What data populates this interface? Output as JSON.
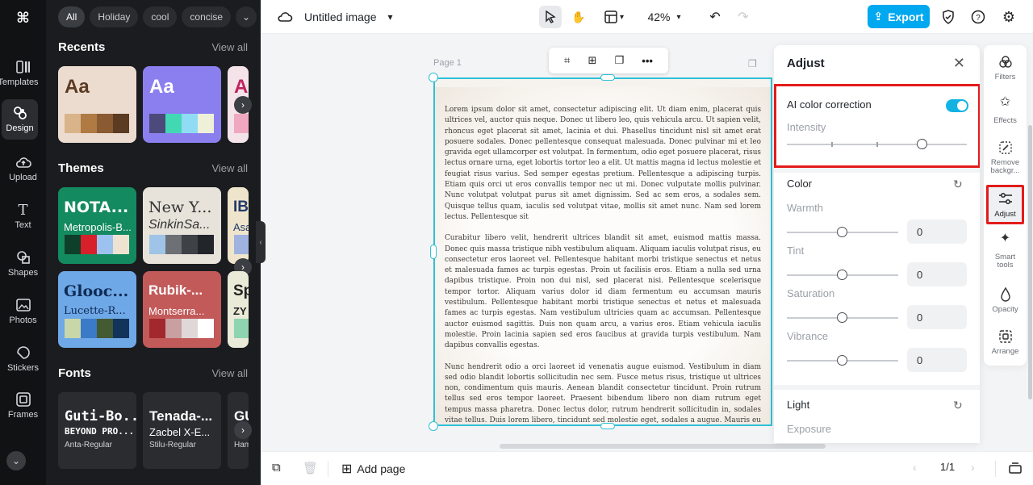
{
  "left_rail": {
    "logo": "⌘",
    "items": [
      {
        "label": "Templates"
      },
      {
        "label": "Design"
      },
      {
        "label": "Upload"
      },
      {
        "label": "Text"
      },
      {
        "label": "Shapes"
      },
      {
        "label": "Photos"
      },
      {
        "label": "Stickers"
      },
      {
        "label": "Frames"
      }
    ]
  },
  "panel": {
    "chips": [
      "All",
      "Holiday",
      "cool",
      "concise"
    ],
    "recents": {
      "title": "Recents",
      "view_all": "View all"
    },
    "recent_cards": [
      {
        "text": "Aa",
        "bg": "#ecdcd0",
        "color": "#5b3b22",
        "swatches": [
          "#d9b48a",
          "#b07a45",
          "#8a5a33",
          "#5b3b22"
        ]
      },
      {
        "text": "Aa",
        "bg": "#8b7ff0",
        "color": "#ffffff",
        "swatches": [
          "#4b4a7a",
          "#43d8b4",
          "#8fdcf4",
          "#eef0d8"
        ]
      },
      {
        "text": "A",
        "bg": "#f4e4ea",
        "color": "#c0245e",
        "swatches": [
          "#f0a8c0",
          "#e6e6e6"
        ]
      }
    ],
    "themes": {
      "title": "Themes",
      "view_all": "View all"
    },
    "theme_cards": [
      {
        "name": "NOTA...",
        "sub": "Metropolis-B...",
        "bg": "#138a5f",
        "color": "#ffffff",
        "swatches": [
          "#0e3f2b",
          "#d8202a",
          "#9cc2f0",
          "#eee2d0"
        ]
      },
      {
        "name": "New Y...",
        "sub": "SinkinSa...",
        "bg": "#e7e2da",
        "color": "#333333",
        "swatches": [
          "#9fc4e8",
          "#6d7075",
          "#3e4247",
          "#22262b"
        ]
      },
      {
        "name": "IB",
        "sub": "Asa",
        "bg": "#efe5cc",
        "color": "#223a6a",
        "swatches": [
          "#9fb2e0"
        ]
      },
      {
        "name": "Glooc...",
        "sub": "Lucette-R...",
        "bg": "#6fa8e6",
        "color": "#0e2a55",
        "swatches": [
          "#c8d6a8",
          "#3b7ac8",
          "#435a32",
          "#12345a"
        ]
      },
      {
        "name": "Rubik-...",
        "sub": "Montserra...",
        "bg": "#c25a5a",
        "color": "#ffffff",
        "swatches": [
          "#a3282e",
          "#c8a0a0",
          "#e0d8d8",
          "#ffffff"
        ]
      },
      {
        "name": "Sp",
        "sub": "ZY",
        "bg": "#e9ead8",
        "color": "#222222",
        "swatches": [
          "#8fd4b0"
        ]
      }
    ],
    "fonts": {
      "title": "Fonts",
      "view_all": "View all"
    },
    "font_cards": [
      {
        "l1": "Guti-Bo...",
        "l2": "BEYOND PRO...",
        "l3": "Anta-Regular"
      },
      {
        "l1": "Tenada-...",
        "l2": "Zacbel X-E...",
        "l3": "Stilu-Regular"
      },
      {
        "l1": "GU",
        "l2": "",
        "l3": "Ham"
      }
    ]
  },
  "topbar": {
    "doc_title": "Untitled image",
    "zoom": "42%",
    "export_label": "Export"
  },
  "canvas": {
    "page_label": "Page 1",
    "paragraphs": [
      "Lorem ipsum dolor sit amet, consectetur adipiscing elit. Ut diam enim, placerat quis ultrices vel, auctor quis neque. Donec ut libero leo, quis vehicula arcu. Ut sapien velit, rhoncus eget placerat sit amet, lacinia et dui. Phasellus tincidunt nisl sit amet erat posuere sodales. Donec pellentesque consequat malesuada. Donec pulvinar mi et leo gravida eget ullamcorper est volutpat. In fermentum, odio eget posuere placerat, risus lectus ornare urna, eget lobortis tortor leo a elit. Ut mattis magna id lectus molestie et feugiat risus varius. Sed semper egestas pretium. Pellentesque a adipiscing turpis. Etiam quis orci ut eros convallis tempor nec ut mi. Donec vulputate mollis pulvinar. Nunc volutpat volutpat purus sit amet dignissim. Sed ac sem eros, a sodales sem. Quisque tellus quam, iaculis sed volutpat vitae, mollis sit amet nunc. Nam sed lorem lectus. Pellentesque sit",
      "Curabitur libero velit, hendrerit ultrices blandit sit amet, euismod mattis massa. Donec quis massa tristique nibh vestibulum aliquam. Aliquam iaculis volutpat risus, eu consectetur eros laoreet vel. Pellentesque habitant morbi tristique senectus et netus et malesuada fames ac turpis egestas. Proin ut facilisis eros. Etiam a nulla sed urna dapibus tristique. Proin non dui nisl, sed placerat nisi. Pellentesque scelerisque tempor tortor. Aliquam varius dolor id diam fermentum eu accumsan mauris vestibulum. Pellentesque habitant morbi tristique senectus et netus et malesuada fames ac turpis egestas. Nam vestibulum ultricies quam ac accumsan. Pellentesque auctor euismod sagittis. Duis non quam arcu, a varius eros. Etiam vehicula iaculis molestie. Proin lacinia sapien sed eros faucibus at gravida turpis vestibulum. Nam dapibus convallis egestas.",
      "Nunc hendrerit odio a orci laoreet id venenatis augue euismod. Vestibulum in diam sed odio blandit lobortis sollicitudin nec sem. Fusce metus risus, tristique ut ultrices non, condimentum quis mauris. Aenean blandit consectetur tincidunt. Proin rutrum tellus sed eros tempor laoreet. Praesent bibendum libero non diam rutrum eget tempus massa pharetra. Donec lectus dolor, rutrum hendrerit sollicitudin in, sodales vitae tellus. Duis lorem libero, tincidunt sed molestie eget, sodales a augue. Mauris eu libero ipsum, ac pellentesque odio. Quisque feugiat risus ut magna blandit sodales. Nunc dig"
    ]
  },
  "bottombar": {
    "add_page": "Add page",
    "page_counter": "1/1"
  },
  "adjust": {
    "title": "Adjust",
    "ai_label": "AI color correction",
    "ai_enabled": true,
    "intensity_label": "Intensity",
    "intensity_level": 0.75,
    "color_title": "Color",
    "sliders": [
      {
        "label": "Warmth",
        "value": "0"
      },
      {
        "label": "Tint",
        "value": "0"
      },
      {
        "label": "Saturation",
        "value": "0"
      },
      {
        "label": "Vibrance",
        "value": "0"
      }
    ],
    "light_title": "Light",
    "exposure_label": "Exposure"
  },
  "right_tools": [
    {
      "label": "Filters",
      "icon": "filters-icon"
    },
    {
      "label": "Effects",
      "icon": "effects-icon"
    },
    {
      "label": "Remove backgr...",
      "icon": "remove-bg-icon"
    },
    {
      "label": "Adjust",
      "icon": "adjust-icon"
    },
    {
      "label": "Smart tools",
      "icon": "smart-tools-icon"
    },
    {
      "label": "Opacity",
      "icon": "opacity-icon"
    },
    {
      "label": "Arrange",
      "icon": "arrange-icon"
    }
  ],
  "colors": {
    "accent": "#00a8f0",
    "selection": "#30c0d8",
    "highlight": "#e31b1b"
  }
}
